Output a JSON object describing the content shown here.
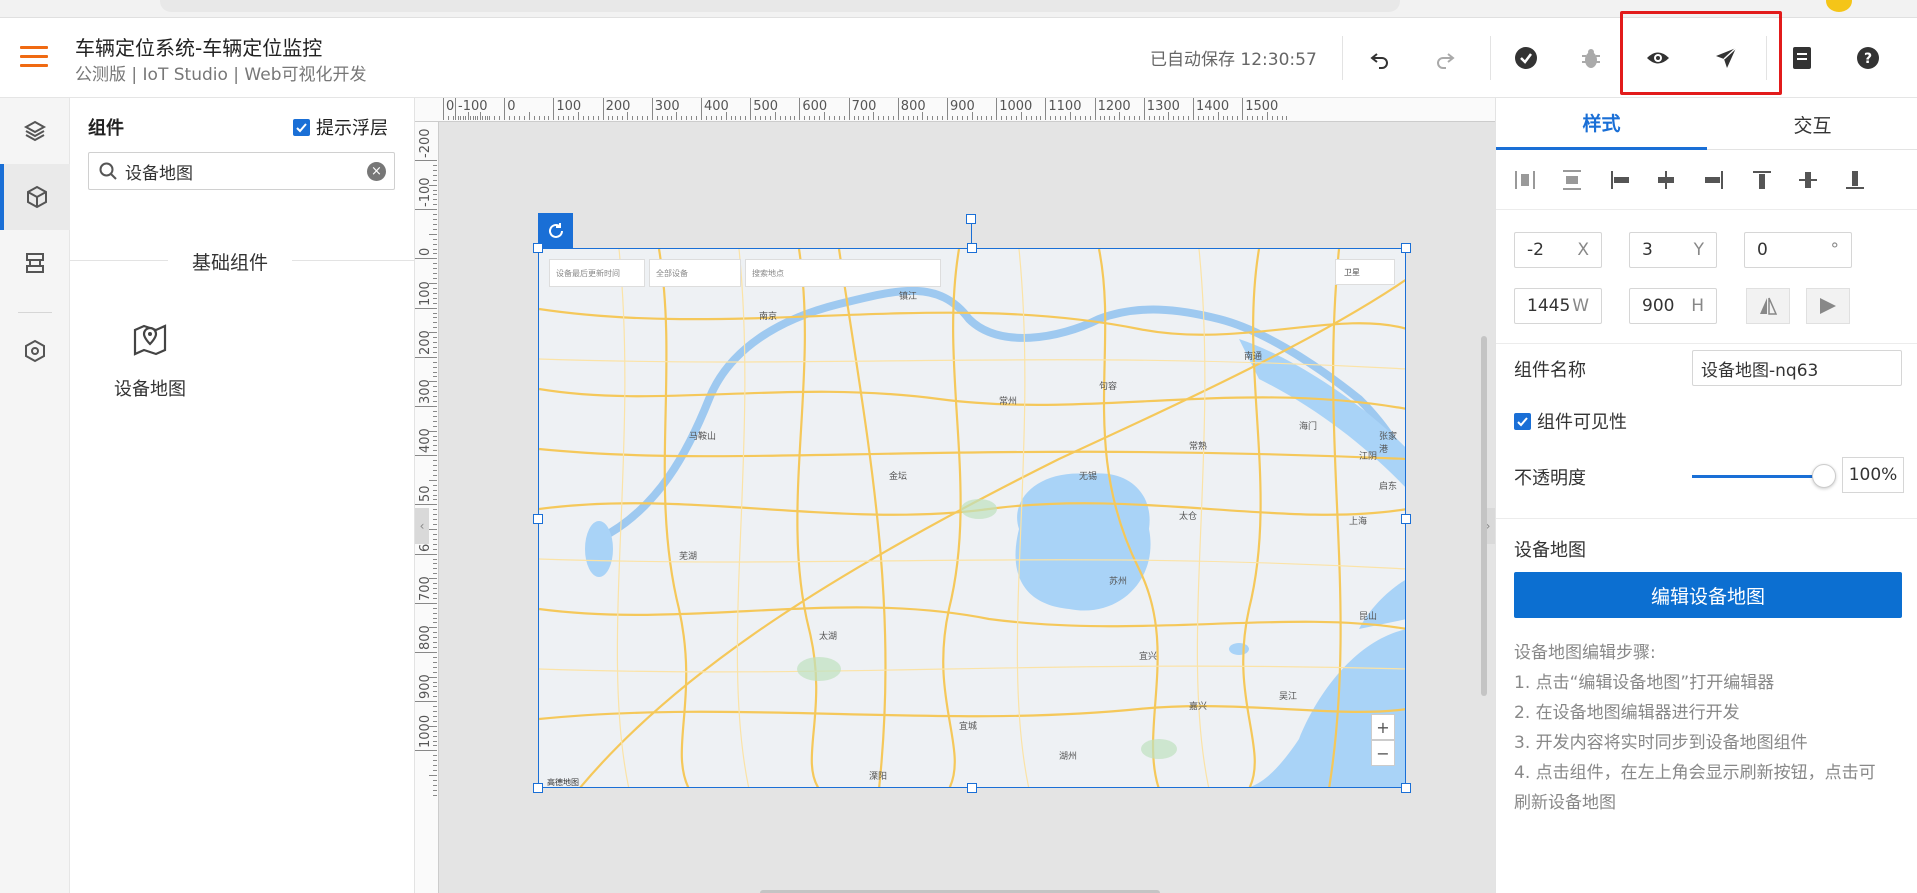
{
  "header": {
    "title": "车辆定位系统-车辆定位监控",
    "subtitle": "公测版 | IoT Studio | Web可视化开发",
    "autosave": "已自动保存 12:30:57"
  },
  "panel": {
    "title": "组件",
    "hint_label": "提示浮层",
    "search_value": "设备地图",
    "section": "基础组件",
    "component_label": "设备地图"
  },
  "rulers": {
    "top": [
      "0",
      "-100",
      "0",
      "100",
      "200",
      "300",
      "400",
      "500",
      "600",
      "700",
      "800",
      "900",
      "1000",
      "1100",
      "1200",
      "1300",
      "1400",
      "1500"
    ],
    "left": [
      "-200",
      "-100",
      "0",
      "100",
      "200",
      "300",
      "400",
      "50",
      "600",
      "700",
      "800",
      "900",
      "1000"
    ]
  },
  "map": {
    "search1": "设备最后更新时间",
    "search2": "全部设备",
    "search3": "搜索地点",
    "satellite": "卫星",
    "zoom_in": "+",
    "zoom_out": "−",
    "attribution": "高德地图",
    "places": [
      "镇江",
      "南京",
      "马鞍山",
      "芜湖",
      "常州",
      "无锡",
      "苏州",
      "上海",
      "南通",
      "湖州",
      "嘉兴",
      "太湖",
      "宜城",
      "溧阳",
      "宜兴",
      "吴江",
      "昆山",
      "太仓",
      "金坛",
      "句容",
      "江阴",
      "张家港",
      "常熟",
      "海门",
      "启东"
    ]
  },
  "rpanel": {
    "tab_style": "样式",
    "tab_interact": "交互",
    "x": "-2",
    "x_unit": "X",
    "y": "3",
    "y_unit": "Y",
    "rot": "0",
    "rot_unit": "°",
    "w": "1445",
    "w_unit": "W",
    "h": "900",
    "h_unit": "H",
    "name_label": "组件名称",
    "name_value": "设备地图-nq63",
    "visible_label": "组件可见性",
    "opacity_label": "不透明度",
    "opacity_value": "100%",
    "opacity": 1.0,
    "section_title": "设备地图",
    "edit_button": "编辑设备地图",
    "steps_title": "设备地图编辑步骤:",
    "step1": "1. 点击“编辑设备地图”打开编辑器",
    "step2": "2. 在设备地图编辑器进行开发",
    "step3": "3. 开发内容将实时同步到设备地图组件",
    "step4a": "4. 点击组件，在左上角会显示刷新按钮，点击可",
    "step4b": "刷新设备地图"
  },
  "colors": {
    "accent": "#1a6fd6",
    "menu": "#f06a12",
    "highlight": "#e21b1b"
  }
}
